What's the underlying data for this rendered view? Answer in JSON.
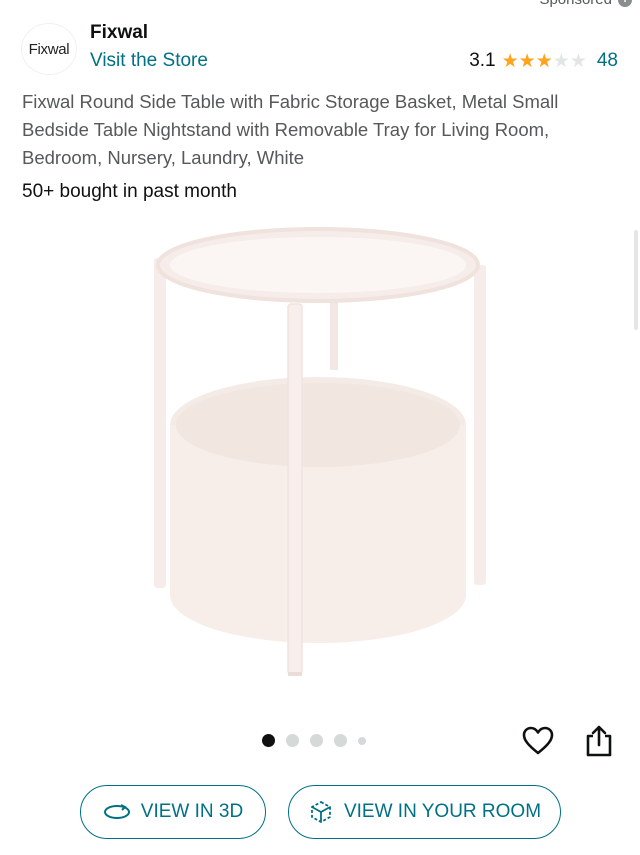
{
  "sponsored_label": "Sponsored",
  "brand": {
    "logo_text": "Fixwal",
    "name": "Fixwal",
    "store_link": "Visit the Store"
  },
  "rating": {
    "value": "3.1",
    "stars_out_of_5": 3.1,
    "count": "48"
  },
  "product": {
    "title": "Fixwal Round Side Table with Fabric Storage Basket, Metal Small Bedside Table Nightstand with Removable Tray for Living Room, Bedroom, Nursery, Laundry, White",
    "bought": "50+ bought in past month"
  },
  "carousel": {
    "count": 5,
    "active_index": 0
  },
  "buttons": {
    "view_3d": "VIEW IN 3D",
    "view_room": "VIEW IN YOUR ROOM"
  },
  "colors": {
    "link": "#007185",
    "star": "#ffa41c",
    "text": "#0f1111",
    "muted": "#565959"
  },
  "icons": {
    "info": "info-icon",
    "heart": "heart-icon",
    "share": "share-icon",
    "rotate3d": "rotate-3d-icon",
    "ar": "ar-cube-icon"
  }
}
